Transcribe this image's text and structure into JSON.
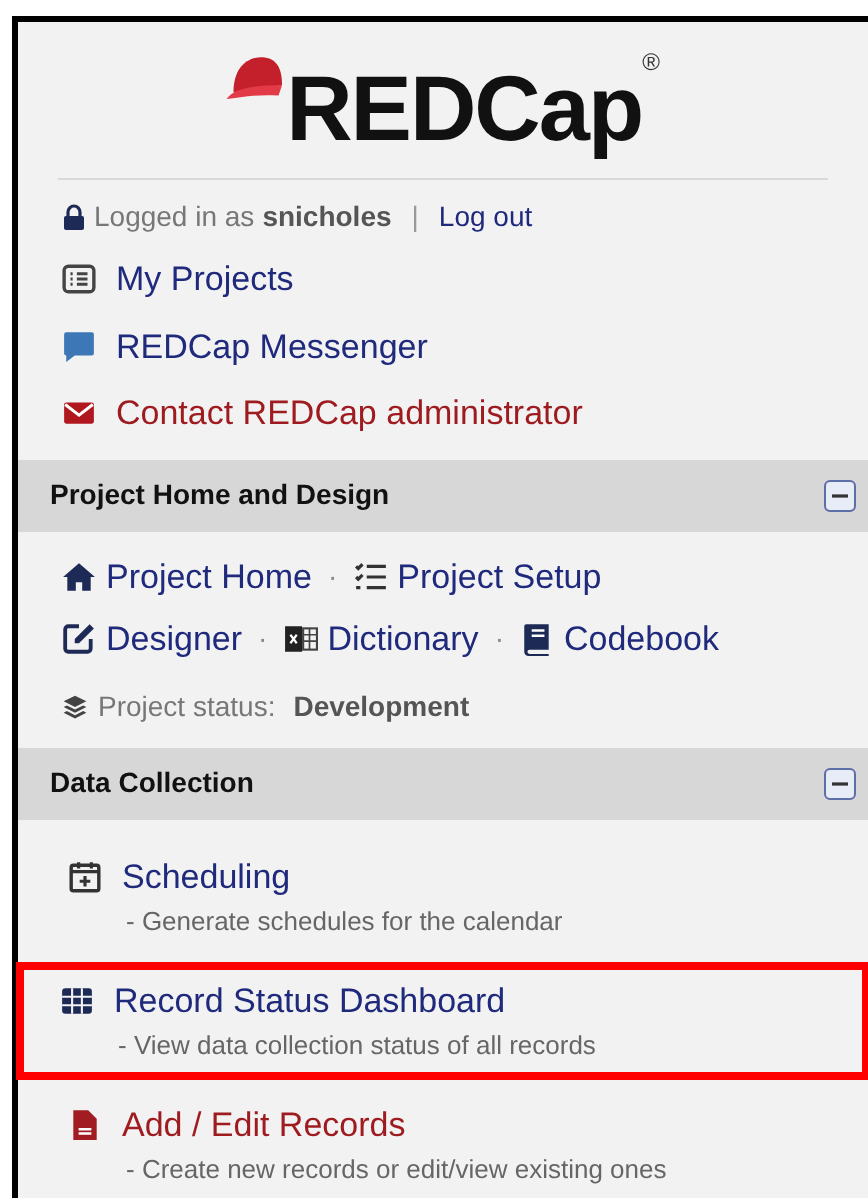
{
  "logo": {
    "text": "REDCap",
    "mark": "®"
  },
  "login": {
    "prefix": "Logged in as",
    "user": "snicholes",
    "separator": "|",
    "logout": "Log out"
  },
  "top_links": [
    {
      "label": "My Projects",
      "kind": "list"
    },
    {
      "label": "REDCap Messenger",
      "kind": "chat"
    },
    {
      "label": "Contact REDCap administrator",
      "kind": "mail"
    }
  ],
  "sections": [
    {
      "title": "Project Home and Design",
      "expanded": true,
      "kind": "design",
      "link_rows": [
        [
          {
            "label": "Project Home",
            "kind": "home"
          },
          {
            "label": "Project Setup",
            "kind": "checklist"
          }
        ],
        [
          {
            "label": "Designer",
            "kind": "edit"
          },
          {
            "label": "Dictionary",
            "kind": "sheet"
          },
          {
            "label": "Codebook",
            "kind": "book"
          }
        ]
      ],
      "separator": "·",
      "status": {
        "label": "Project status:",
        "value": "Development"
      }
    },
    {
      "title": "Data Collection",
      "expanded": true,
      "kind": "tools",
      "items": [
        {
          "label": "Scheduling",
          "kind": "calendar",
          "description": "- Generate schedules for the calendar",
          "highlighted": false
        },
        {
          "label": "Record Status Dashboard",
          "kind": "grid",
          "description": "- View data collection status of all records",
          "highlighted": true
        },
        {
          "label": "Add / Edit Records",
          "kind": "file",
          "description": "- Create new records or edit/view existing ones",
          "highlighted": false
        }
      ]
    }
  ]
}
